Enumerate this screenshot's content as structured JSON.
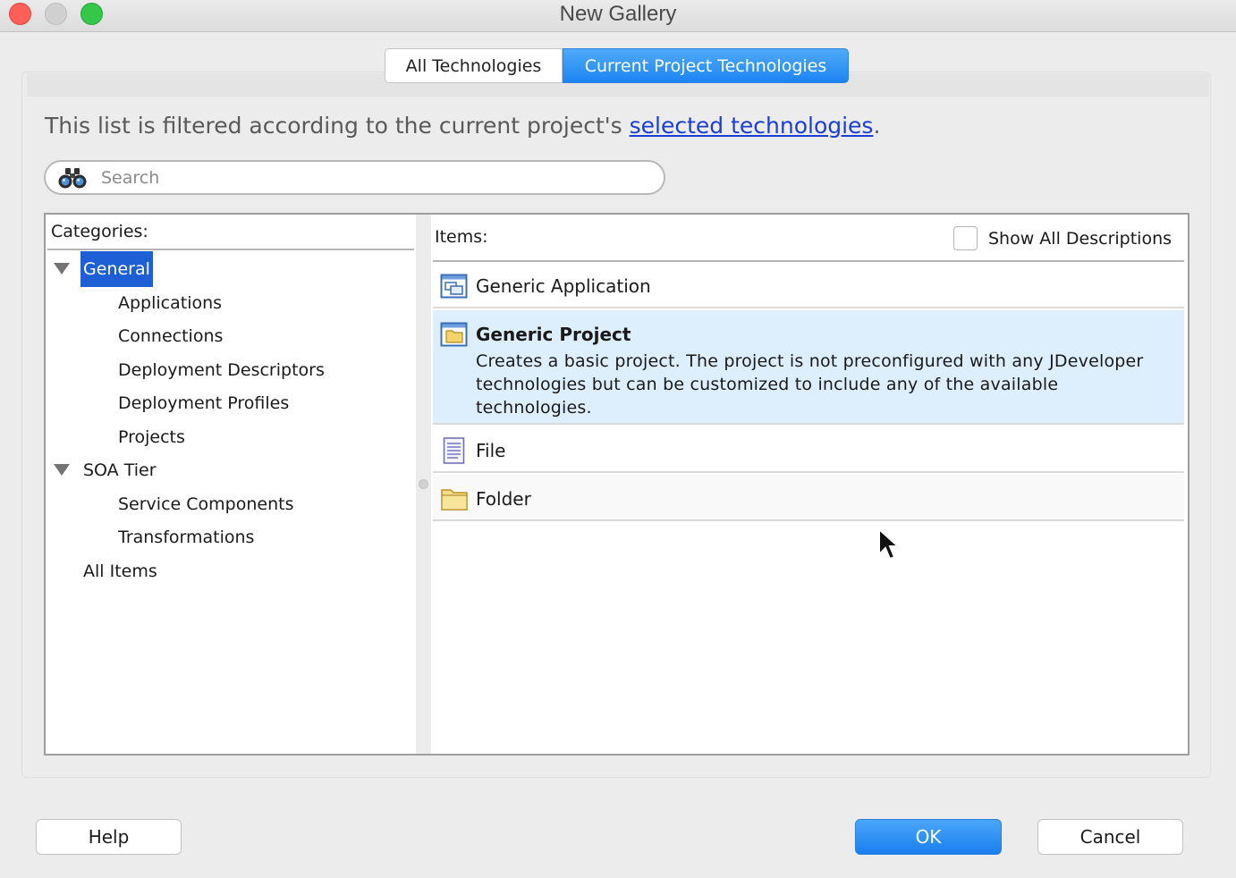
{
  "window": {
    "title": "New Gallery"
  },
  "tabs": [
    {
      "label": "All Technologies",
      "active": false
    },
    {
      "label": "Current Project Technologies",
      "active": true
    }
  ],
  "filter": {
    "text": "This list is filtered according to the current project's ",
    "link": "selected technologies",
    "suffix": "."
  },
  "search": {
    "placeholder": "Search",
    "value": ""
  },
  "categories": {
    "header": "Categories:",
    "tree": [
      {
        "label": "General",
        "level": 0,
        "expanded": true,
        "selected": true
      },
      {
        "label": "Applications",
        "level": 1
      },
      {
        "label": "Connections",
        "level": 1
      },
      {
        "label": "Deployment Descriptors",
        "level": 1
      },
      {
        "label": "Deployment Profiles",
        "level": 1
      },
      {
        "label": "Projects",
        "level": 1
      },
      {
        "label": "SOA Tier",
        "level": 0,
        "expanded": true
      },
      {
        "label": "Service Components",
        "level": 1
      },
      {
        "label": "Transformations",
        "level": 1
      },
      {
        "label": "All Items",
        "level": 0
      }
    ]
  },
  "items": {
    "header": "Items:",
    "show_all_descriptions": {
      "label": "Show All Descriptions",
      "checked": false
    },
    "list": [
      {
        "name": "Generic Application",
        "icon": "application-icon"
      },
      {
        "name": "Generic Project",
        "icon": "project-icon",
        "selected": true,
        "description": "Creates a basic project. The project is not preconfigured with any JDeveloper technologies but can be customized to include any of the available technologies."
      },
      {
        "name": "File",
        "icon": "file-icon"
      },
      {
        "name": "Folder",
        "icon": "folder-icon"
      }
    ]
  },
  "buttons": {
    "help": "Help",
    "ok": "OK",
    "cancel": "Cancel"
  },
  "colors": {
    "accent": "#1d84f2",
    "selection": "#1f5fd6",
    "selected_row": "#ddeefc",
    "link": "#1a3ed6"
  }
}
